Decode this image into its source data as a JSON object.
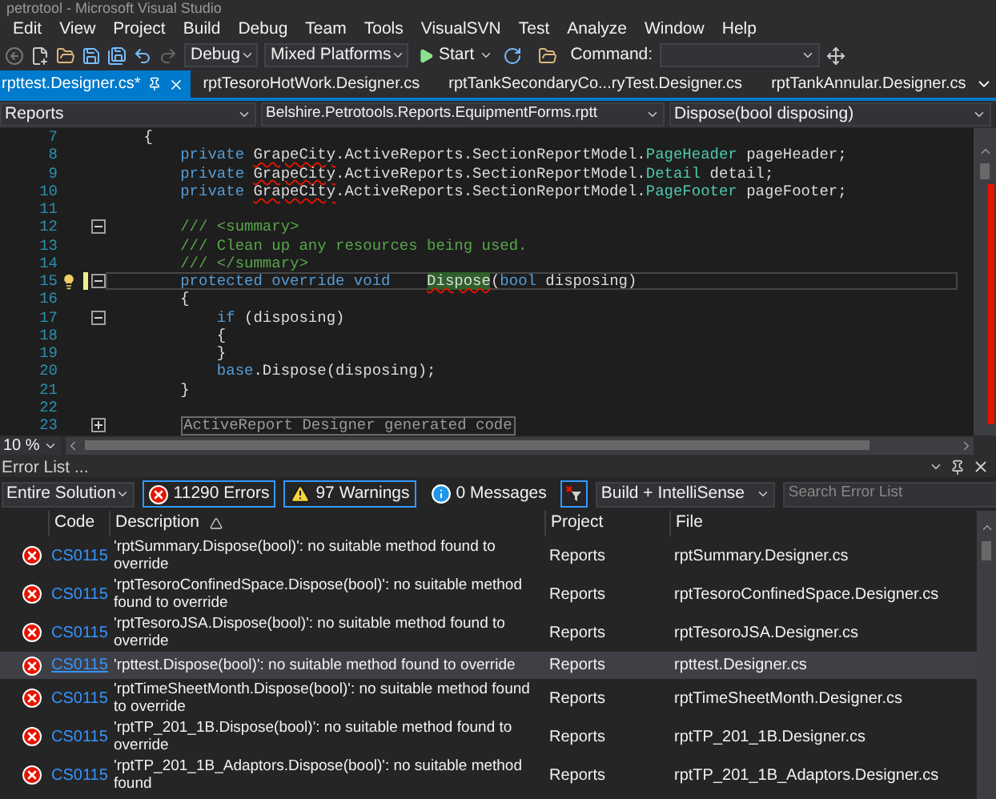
{
  "window": {
    "title": "petrotool - Microsoft Visual Studio"
  },
  "menu": [
    "Edit",
    "View",
    "Project",
    "Build",
    "Debug",
    "Team",
    "Tools",
    "VisualSVN",
    "Test",
    "Analyze",
    "Window",
    "Help"
  ],
  "toolbar": {
    "configuration": "Debug",
    "platform": "Mixed Platforms",
    "start": "Start",
    "command_label": "Command:"
  },
  "tabs": [
    {
      "label": "rpttest.Designer.cs*",
      "selected": true
    },
    {
      "label": "rptTesoroHotWork.Designer.cs",
      "selected": false
    },
    {
      "label": "rptTankSecondaryCo...ryTest.Designer.cs",
      "selected": false
    },
    {
      "label": "rptTankAnnular.Designer.cs",
      "selected": false
    }
  ],
  "navigation_bar": {
    "project": "Reports",
    "type": "Belshire.Petrotools.Reports.EquipmentForms.rptt",
    "member": "Dispose(bool disposing)"
  },
  "editor": {
    "zoom": "10 %",
    "lines": [
      {
        "number": "7",
        "current": false,
        "segments": [
          {
            "kind": "plain",
            "text": "    {"
          }
        ]
      },
      {
        "number": "8",
        "current": false,
        "segments": [
          {
            "kind": "keyword",
            "text": "        private "
          },
          {
            "kind": "squiggle",
            "text": "GrapeCity"
          },
          {
            "kind": "plain",
            "text": ".ActiveReports.SectionReportModel."
          },
          {
            "kind": "type",
            "text": "PageHeader"
          },
          {
            "kind": "plain",
            "text": " pageHeader;"
          }
        ]
      },
      {
        "number": "9",
        "current": false,
        "segments": [
          {
            "kind": "keyword",
            "text": "        private "
          },
          {
            "kind": "squiggle",
            "text": "GrapeCity"
          },
          {
            "kind": "plain",
            "text": ".ActiveReports.SectionReportModel."
          },
          {
            "kind": "type",
            "text": "Detail"
          },
          {
            "kind": "plain",
            "text": " detail;"
          }
        ]
      },
      {
        "number": "10",
        "current": false,
        "segments": [
          {
            "kind": "keyword",
            "text": "        private "
          },
          {
            "kind": "squiggle",
            "text": "GrapeCity"
          },
          {
            "kind": "plain",
            "text": ".ActiveReports.SectionReportModel."
          },
          {
            "kind": "type",
            "text": "PageFooter"
          },
          {
            "kind": "plain",
            "text": " pageFooter;"
          }
        ]
      },
      {
        "number": "11",
        "current": false
      },
      {
        "number": "12",
        "current": false,
        "folding": {
          "expanded": true
        },
        "segments": [
          {
            "kind": "comment",
            "text": "        /// <summary>"
          }
        ]
      },
      {
        "number": "13",
        "current": false,
        "segments": [
          {
            "kind": "comment",
            "text": "        /// Clean up any resources being used."
          }
        ]
      },
      {
        "number": "14",
        "current": false,
        "segments": [
          {
            "kind": "comment",
            "text": "        /// </summary>"
          }
        ]
      },
      {
        "number": "15",
        "current": true,
        "folding": {
          "expanded": true
        },
        "segments": [
          {
            "kind": "keyword",
            "text": "        protected override void    "
          },
          {
            "kind": "highlight",
            "text": "Dispose"
          },
          {
            "kind": "plain",
            "text": "("
          },
          {
            "kind": "keyword",
            "text": "bool"
          },
          {
            "kind": "plain",
            "text": " disposing)"
          }
        ]
      },
      {
        "number": "16",
        "current": false,
        "segments": [
          {
            "kind": "plain",
            "text": "        {"
          }
        ]
      },
      {
        "number": "17",
        "current": false,
        "folding": {
          "expanded": true
        },
        "segments": [
          {
            "kind": "keyword",
            "text": "            if"
          },
          {
            "kind": "plain",
            "text": " (disposing)"
          }
        ]
      },
      {
        "number": "18",
        "current": false,
        "segments": [
          {
            "kind": "plain",
            "text": "            {"
          }
        ]
      },
      {
        "number": "19",
        "current": false,
        "segments": [
          {
            "kind": "plain",
            "text": "            }"
          }
        ]
      },
      {
        "number": "20",
        "current": false,
        "segments": [
          {
            "kind": "keyword",
            "text": "            base"
          },
          {
            "kind": "plain",
            "text": ".Dispose(disposing);"
          }
        ]
      },
      {
        "number": "21",
        "current": false,
        "segments": [
          {
            "kind": "plain",
            "text": "        }"
          }
        ]
      },
      {
        "number": "22",
        "current": false
      },
      {
        "number": "23",
        "current": false,
        "folding": {
          "expanded": false
        },
        "region": "ActiveReport Designer generated code"
      }
    ]
  },
  "error_list": {
    "title": "Error List ...",
    "scope": "Entire Solution",
    "filters": [
      {
        "kind": "error",
        "label": "11290 Errors",
        "selected": true
      },
      {
        "kind": "warning",
        "label": "97 Warnings",
        "selected": true
      },
      {
        "kind": "message",
        "label": "0 Messages",
        "selected": false
      }
    ],
    "source": "Build + IntelliSense",
    "search": {
      "placeholder": "Search Error List"
    },
    "columns": [
      {
        "label": "Code",
        "sorted": false
      },
      {
        "label": "Description",
        "sorted": true
      },
      {
        "label": "Project",
        "sorted": false
      },
      {
        "label": "File",
        "sorted": false
      }
    ],
    "rows": [
      {
        "kind": "error",
        "code": "CS0115",
        "description": "'rptSummary.Dispose(bool)': no suitable method found to override",
        "project": "Reports",
        "file": "rptSummary.Designer.cs",
        "selected": false
      },
      {
        "kind": "error",
        "code": "CS0115",
        "description": "'rptTesoroConfinedSpace.Dispose(bool)': no suitable method found to override",
        "project": "Reports",
        "file": "rptTesoroConfinedSpace.Designer.cs",
        "selected": false
      },
      {
        "kind": "error",
        "code": "CS0115",
        "description": "'rptTesoroJSA.Dispose(bool)': no suitable method found to override",
        "project": "Reports",
        "file": "rptTesoroJSA.Designer.cs",
        "selected": false
      },
      {
        "kind": "error",
        "code": "CS0115",
        "description": "'rpttest.Dispose(bool)': no suitable method found to override",
        "project": "Reports",
        "file": "rpttest.Designer.cs",
        "selected": true
      },
      {
        "kind": "error",
        "code": "CS0115",
        "description": "'rptTimeSheetMonth.Dispose(bool)': no suitable method found to override",
        "project": "Reports",
        "file": "rptTimeSheetMonth.Designer.cs",
        "selected": false
      },
      {
        "kind": "error",
        "code": "CS0115",
        "description": "'rptTP_201_1B.Dispose(bool)': no suitable method found to override",
        "project": "Reports",
        "file": "rptTP_201_1B.Designer.cs",
        "selected": false
      },
      {
        "kind": "error",
        "code": "CS0115",
        "description": "'rptTP_201_1B_Adaptors.Dispose(bool)': no suitable method found",
        "project": "Reports",
        "file": "rptTP_201_1B_Adaptors.Designer.cs",
        "selected": false
      }
    ]
  }
}
